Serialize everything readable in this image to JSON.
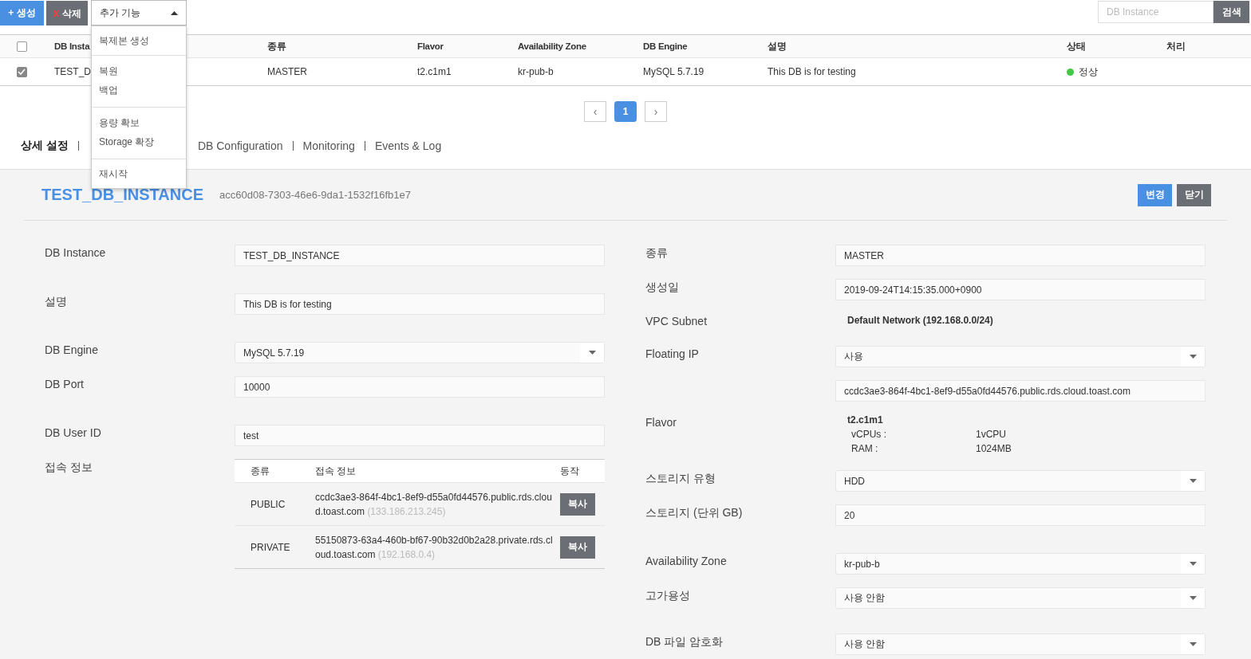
{
  "toolbar": {
    "create": {
      "icon": "+",
      "label": "생성"
    },
    "delete": {
      "icon": "x",
      "label": "삭제"
    },
    "more": {
      "label": "추가 기능",
      "expanded": true,
      "groups": [
        [
          "복제본 생성"
        ],
        [
          "복원",
          "백업"
        ],
        [
          "용량 확보",
          "Storage 확장"
        ],
        [
          "재시작"
        ]
      ]
    },
    "search": {
      "placeholder": "DB Instance",
      "button": "검색"
    }
  },
  "table": {
    "columns": [
      "DB Insta",
      "종류",
      "Flavor",
      "Availability Zone",
      "DB Engine",
      "설명",
      "상태",
      "처리"
    ],
    "all_checked": false,
    "rows": [
      {
        "checked": true,
        "cells": [
          "TEST_D",
          "MASTER",
          "t2.c1m1",
          "kr-pub-b",
          "MySQL 5.7.19",
          "This DB is for testing"
        ],
        "status": {
          "label": "정상",
          "color": "#44c944"
        }
      }
    ]
  },
  "pagination": {
    "prev": "‹",
    "next": "›",
    "pages": [
      {
        "label": "1",
        "selected": true
      }
    ]
  },
  "tabs": [
    {
      "label": "상세 설정",
      "selected": true
    },
    {
      "label": "DB Configuration",
      "selected": false
    },
    {
      "label": "Monitoring",
      "selected": false
    },
    {
      "label": "Events & Log",
      "selected": false
    }
  ],
  "detail": {
    "title": "TEST_DB_INSTANCE",
    "id": "acc60d08-7303-46e6-9da1-1532f16fb1e7",
    "buttons": [
      {
        "label": "변경",
        "kind": "primary"
      },
      {
        "label": "닫기",
        "kind": "secondary"
      }
    ],
    "left": [
      {
        "kind": "input",
        "label": "DB Instance",
        "value": "TEST_DB_INSTANCE"
      },
      {
        "kind": "input",
        "label": "설명",
        "value": "This DB is for testing"
      },
      {
        "kind": "select",
        "label": "DB Engine",
        "value": "MySQL 5.7.19"
      },
      {
        "kind": "input",
        "label": "DB Port",
        "value": "10000"
      },
      {
        "kind": "input",
        "label": "DB User ID",
        "value": "test"
      },
      {
        "kind": "table",
        "label": "접속 정보",
        "columns": [
          "종류",
          "접속 정보",
          "동작"
        ],
        "rows": [
          {
            "type": "PUBLIC",
            "host": "ccdc3ae3-864f-4bc1-8ef9-d55a0fd44576.public.rds.cloud.toast.com",
            "ip": "(133.186.213.245)",
            "action": "복사"
          },
          {
            "type": "PRIVATE",
            "host": "55150873-63a4-460b-bf67-90b32d0b2a28.private.rds.cloud.toast.com",
            "ip": "(192.168.0.4)",
            "action": "복사"
          }
        ]
      }
    ],
    "right": [
      {
        "kind": "input",
        "label": "종류",
        "value": "MASTER"
      },
      {
        "kind": "input",
        "label": "생성일",
        "value": "2019-09-24T14:15:35.000+0900"
      },
      {
        "kind": "text",
        "label": "VPC Subnet",
        "value": "Default Network (192.168.0.0/24)"
      },
      {
        "kind": "select",
        "label": "Floating IP",
        "value": "사용"
      },
      {
        "kind": "input",
        "value": "ccdc3ae3-864f-4bc1-8ef9-d55a0fd44576.public.rds.cloud.toast.com"
      },
      {
        "kind": "flavor",
        "label": "Flavor",
        "value": "t2.c1m1",
        "specs": [
          {
            "name": "vCPUs :",
            "value": "1vCPU"
          },
          {
            "name": "RAM :",
            "value": "1024MB"
          }
        ]
      },
      {
        "kind": "select",
        "label": "스토리지 유형",
        "value": "HDD"
      },
      {
        "kind": "input",
        "label": "스토리지 (단위 GB)",
        "value": "20"
      },
      {
        "kind": "select",
        "label": "Availability Zone",
        "value": "kr-pub-b"
      },
      {
        "kind": "select",
        "label": "고가용성",
        "value": "사용 안함"
      },
      {
        "kind": "select",
        "label": "DB 파일 암호화",
        "value": "사용 안함"
      }
    ]
  }
}
